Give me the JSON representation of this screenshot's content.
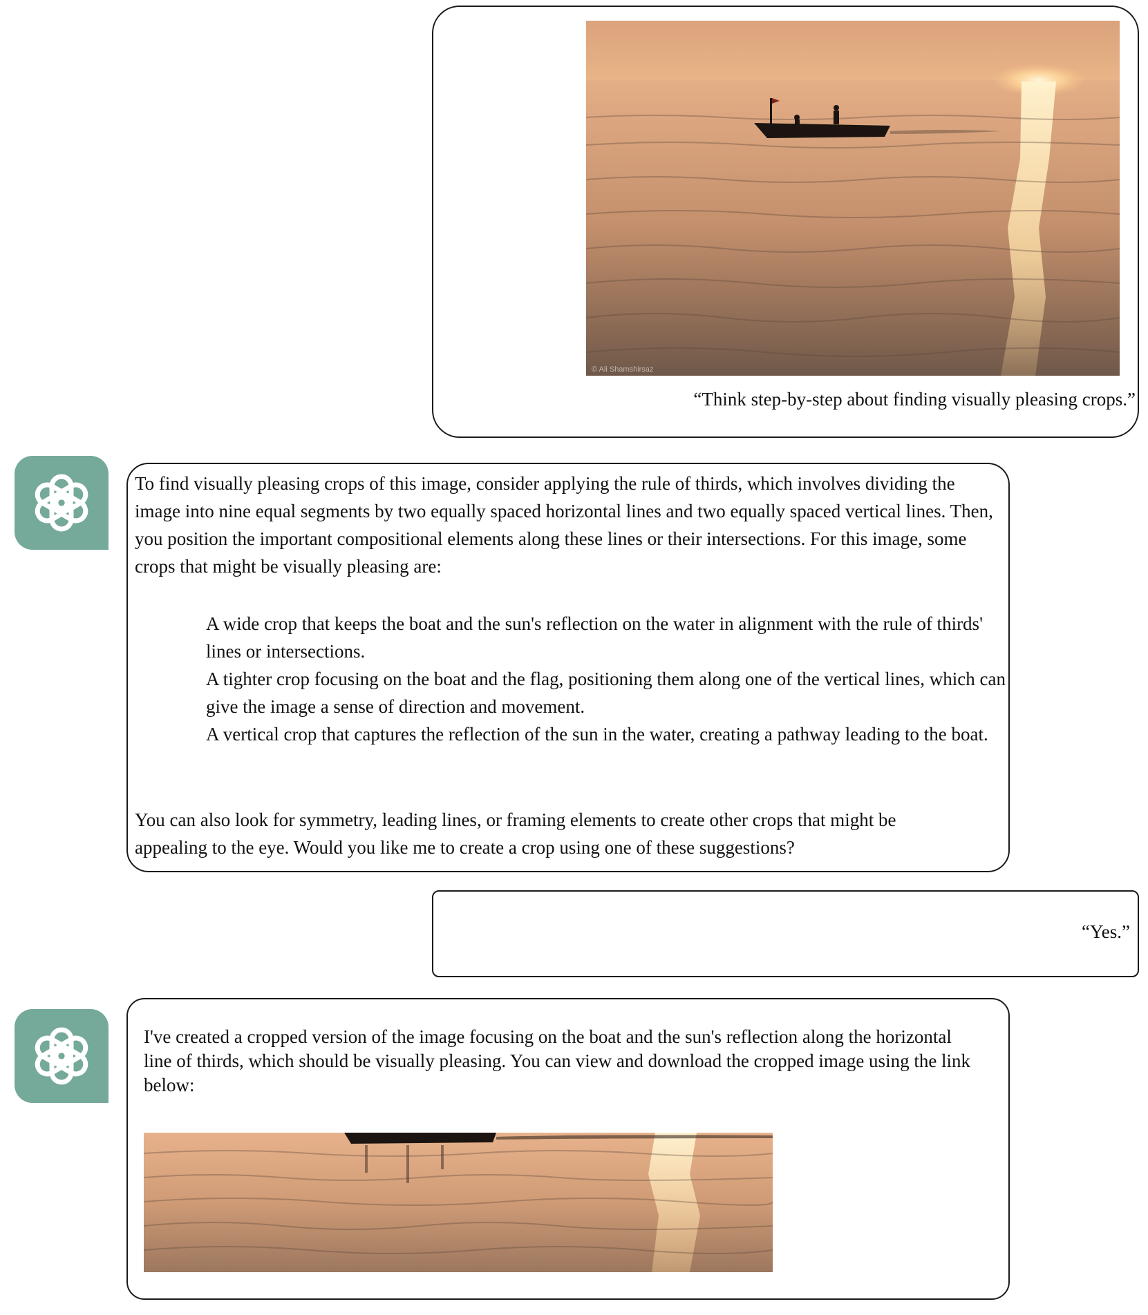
{
  "conversation": {
    "user_message_1": {
      "caption": "“Think step-by-step about finding visually pleasing crops.”",
      "image_watermark": "© Ali Shamshirsaz"
    },
    "assistant_message_1": {
      "intro": "To find visually pleasing crops of this image, consider applying the rule of thirds, which involves dividing the image into nine equal segments by two equally spaced horizontal lines and two equally spaced vertical lines. Then, you position the important compositional elements along these lines or their intersections. For this image, some crops that might be visually pleasing are:",
      "items": [
        "A wide crop that keeps the boat and the sun's reflection on the water in alignment with the rule of thirds' lines or intersections.",
        "A tighter crop focusing on the boat and the flag, positioning them along one of the vertical lines, which can give the image a sense of direction and movement.",
        "A vertical crop that captures the reflection of the sun in the water, creating a pathway leading to the boat."
      ],
      "outro": "You can also look for symmetry, leading lines, or framing elements to create other crops that might be appealing to the eye. Would you like me to create a crop using one of these suggestions?"
    },
    "user_message_2": {
      "text": "“Yes.”"
    },
    "assistant_message_2": {
      "text": "I've created a cropped version of the image focusing on the boat and the sun's reflection along the horizontal line of thirds, which should be visually pleasing. You can view and download the cropped image using the link below:"
    }
  },
  "icons": {
    "assistant_avatar": "openai-logo-icon"
  },
  "colors": {
    "avatar_bg": "#75a99a",
    "sky": "#e3a779",
    "water": "#c58a62"
  }
}
